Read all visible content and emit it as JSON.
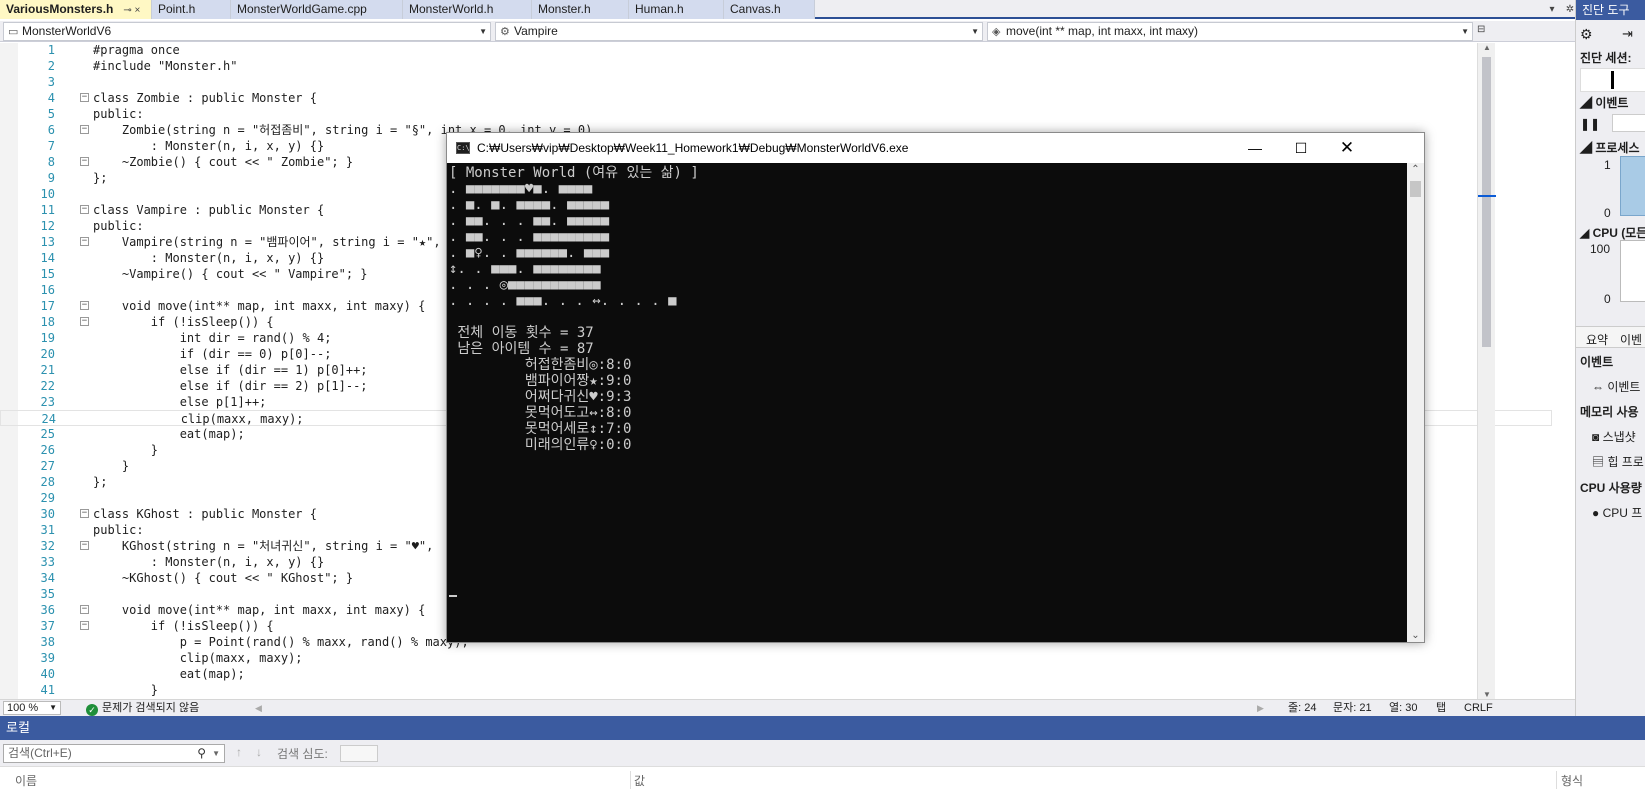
{
  "tabs": [
    {
      "label": "VariousMonsters.h",
      "active": true
    },
    {
      "label": "Point.h"
    },
    {
      "label": "MonsterWorldGame.cpp"
    },
    {
      "label": "MonsterWorld.h"
    },
    {
      "label": "Monster.h"
    },
    {
      "label": "Human.h"
    },
    {
      "label": "Canvas.h"
    }
  ],
  "tab_pin": "⊸ ×",
  "navbar": {
    "project": "MonsterWorldV6",
    "scope": "Vampire",
    "member": "move(int ** map, int maxx, int maxy)"
  },
  "code_lines": [
    {
      "n": "1",
      "t": "#pragma once"
    },
    {
      "n": "2",
      "t": "#include \"Monster.h\""
    },
    {
      "n": "3",
      "t": ""
    },
    {
      "n": "4",
      "t": "class Zombie : public Monster {",
      "fold": true
    },
    {
      "n": "5",
      "t": "public:"
    },
    {
      "n": "6",
      "t": "    Zombie(string n = \"허접좀비\", string i = \"§\", int x = 0, int y = 0)",
      "fold": true
    },
    {
      "n": "7",
      "t": "        : Monster(n, i, x, y) {}"
    },
    {
      "n": "8",
      "t": "    ~Zombie() { cout << \" Zombie\"; }",
      "fold": true
    },
    {
      "n": "9",
      "t": "};"
    },
    {
      "n": "10",
      "t": ""
    },
    {
      "n": "11",
      "t": "class Vampire : public Monster {",
      "fold": true
    },
    {
      "n": "12",
      "t": "public:"
    },
    {
      "n": "13",
      "t": "    Vampire(string n = \"뱀파이어\", string i = \"★\",",
      "fold": true
    },
    {
      "n": "14",
      "t": "        : Monster(n, i, x, y) {}"
    },
    {
      "n": "15",
      "t": "    ~Vampire() { cout << \" Vampire\"; }"
    },
    {
      "n": "16",
      "t": ""
    },
    {
      "n": "17",
      "t": "    void move(int** map, int maxx, int maxy) {",
      "fold": true
    },
    {
      "n": "18",
      "t": "        if (!isSleep()) {",
      "fold": true
    },
    {
      "n": "19",
      "t": "            int dir = rand() % 4;"
    },
    {
      "n": "20",
      "t": "            if (dir == 0) p[0]--;"
    },
    {
      "n": "21",
      "t": "            else if (dir == 1) p[0]++;"
    },
    {
      "n": "22",
      "t": "            else if (dir == 2) p[1]--;"
    },
    {
      "n": "23",
      "t": "            else p[1]++;"
    },
    {
      "n": "24",
      "t": "            clip(maxx, maxy);",
      "current": true
    },
    {
      "n": "25",
      "t": "            eat(map);"
    },
    {
      "n": "26",
      "t": "        }"
    },
    {
      "n": "27",
      "t": "    }"
    },
    {
      "n": "28",
      "t": "};"
    },
    {
      "n": "29",
      "t": ""
    },
    {
      "n": "30",
      "t": "class KGhost : public Monster {",
      "fold": true
    },
    {
      "n": "31",
      "t": "public:"
    },
    {
      "n": "32",
      "t": "    KGhost(string n = \"처녀귀신\", string i = \"♥\",",
      "fold": true
    },
    {
      "n": "33",
      "t": "        : Monster(n, i, x, y) {}"
    },
    {
      "n": "34",
      "t": "    ~KGhost() { cout << \" KGhost\"; }"
    },
    {
      "n": "35",
      "t": ""
    },
    {
      "n": "36",
      "t": "    void move(int** map, int maxx, int maxy) {",
      "fold": true
    },
    {
      "n": "37",
      "t": "        if (!isSleep()) {",
      "fold": true
    },
    {
      "n": "38",
      "t": "            p = Point(rand() % maxx, rand() % maxy);"
    },
    {
      "n": "39",
      "t": "            clip(maxx, maxy);"
    },
    {
      "n": "40",
      "t": "            eat(map);"
    },
    {
      "n": "41",
      "t": "        }"
    }
  ],
  "status": {
    "zoom": "100 %",
    "issues": "문제가 검색되지 않음",
    "line": "줄: 24",
    "char": "문자: 21",
    "col": "열: 30",
    "tab": "탭",
    "eol": "CRLF"
  },
  "local_panel": {
    "title": "로컬",
    "search_placeholder": "검색(Ctrl+E)",
    "search_depth_label": "검색 심도:",
    "col_name": "이름",
    "col_value": "값",
    "col_type": "형식"
  },
  "diag": {
    "title": "진단 도구",
    "session": "진단 세션:",
    "events": "이벤트",
    "process": "프로세스",
    "proc_1": "1",
    "proc_0": "0",
    "cpu": "CPU (모든",
    "cpu_100": "100",
    "cpu_0": "0",
    "tab_summary": "요약",
    "tab_events": "이벤",
    "events_header": "이벤트",
    "events_item": "이벤트",
    "memory": "메모리 사용",
    "snapshot": "스냅샷",
    "heap": "힙 프로",
    "cpu_usage": "CPU 사용량",
    "cpu_item": "CPU 프"
  },
  "console": {
    "title": "C:₩Users₩vip₩Desktop₩Week11_Homework1₩Debug₩MonsterWorldV6.exe",
    "lines": [
      "[ Monster World (여유 있는 삶) ]",
      ". ■■■■■■■♥■. ■■■■",
      ". ■. ■. ■■■■. ■■■■■",
      ". ■■. . . ■■. ■■■■■",
      ". ■■. . . ■■■■■■■■■",
      ". ■♀. . ■■■■■■. ■■■",
      "↕. . ■■■. ■■■■■■■■",
      ". . . ◎■■■■■■■■■■■",
      ". . . . ■■■. . . ↔. . . . ■",
      "",
      " 전체 이동 횟수 = 37",
      " 남은 아이템 수 = 87",
      "         허접한좀비◎:8:0",
      "         뱀파이어짱★:9:0",
      "         어쩌다귀신♥:9:3",
      "         못먹어도고↔:8:0",
      "         못먹어세로↕:7:0",
      "         미래의인류♀:0:0"
    ]
  }
}
